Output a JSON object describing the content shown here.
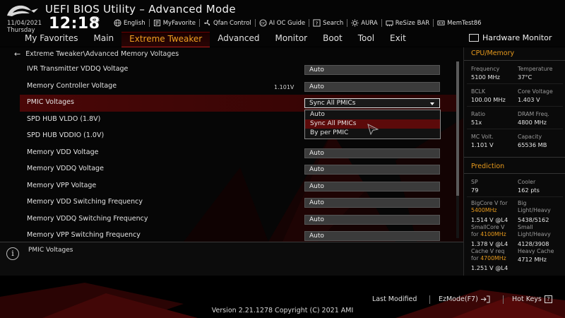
{
  "header": {
    "title": "UEFI BIOS Utility – Advanced Mode",
    "date": "11/04/2021",
    "day": "Thursday",
    "time": "12:18",
    "toolbar": [
      {
        "label": "English",
        "icon": "globe-icon"
      },
      {
        "label": "MyFavorite",
        "icon": "favorite-icon"
      },
      {
        "label": "Qfan Control",
        "icon": "fan-icon"
      },
      {
        "label": "AI OC Guide",
        "icon": "ai-oc-icon"
      },
      {
        "label": "Search",
        "icon": "search-icon"
      },
      {
        "label": "AURA",
        "icon": "aura-icon"
      },
      {
        "label": "ReSize BAR",
        "icon": "resize-bar-icon"
      },
      {
        "label": "MemTest86",
        "icon": "memtest-icon"
      }
    ]
  },
  "nav": {
    "tabs": [
      "My Favorites",
      "Main",
      "Extreme Tweaker",
      "Advanced",
      "Monitor",
      "Boot",
      "Tool",
      "Exit"
    ],
    "active": "Extreme Tweaker"
  },
  "breadcrumb": "Extreme Tweaker\\Advanced Memory Voltages",
  "rows": [
    {
      "label": "IVR Transmitter VDDQ Voltage",
      "measured": "",
      "value": "Auto"
    },
    {
      "label": "Memory Controller Voltage",
      "measured": "1.101V",
      "value": "Auto"
    },
    {
      "label": "PMIC Voltages",
      "measured": "",
      "value": "Sync All PMICs"
    },
    {
      "label": "SPD HUB VLDO (1.8V)",
      "measured": "",
      "value": ""
    },
    {
      "label": "SPD HUB VDDIO (1.0V)",
      "measured": "",
      "value": ""
    },
    {
      "label": "Memory VDD Voltage",
      "measured": "",
      "value": "Auto"
    },
    {
      "label": "Memory VDDQ Voltage",
      "measured": "",
      "value": "Auto"
    },
    {
      "label": "Memory VPP Voltage",
      "measured": "",
      "value": "Auto"
    },
    {
      "label": "Memory VDD Switching Frequency",
      "measured": "",
      "value": "Auto"
    },
    {
      "label": "Memory VDDQ Switching Frequency",
      "measured": "",
      "value": "Auto"
    },
    {
      "label": "Memory VPP Switching Frequency",
      "measured": "",
      "value": "Auto"
    }
  ],
  "dropdown": {
    "options": [
      "Auto",
      "Sync All PMICs",
      "By per PMIC"
    ],
    "selected": "Sync All PMICs"
  },
  "help_text": "PMIC Voltages",
  "hw_monitor": {
    "title": "Hardware Monitor",
    "cpu_memory": {
      "title": "CPU/Memory",
      "frequency_label": "Frequency",
      "frequency": "5100 MHz",
      "temperature_label": "Temperature",
      "temperature": "37°C",
      "bclk_label": "BCLK",
      "bclk": "100.00 MHz",
      "core_voltage_label": "Core Voltage",
      "core_voltage": "1.403 V",
      "ratio_label": "Ratio",
      "ratio": "51x",
      "dram_freq_label": "DRAM Freq.",
      "dram_freq": "4800 MHz",
      "mc_volt_label": "MC Volt.",
      "mc_volt": "1.101 V",
      "capacity_label": "Capacity",
      "capacity": "65536 MB"
    },
    "prediction": {
      "title": "Prediction",
      "sp_label": "SP",
      "sp": "79",
      "cooler_label": "Cooler",
      "cooler": "162 pts",
      "bigcore_label_a": "BigCore V for",
      "bigcore_freq": "5400MHz",
      "bigcore_value": "1.514 V @L4",
      "big_label_a": "Big",
      "big_label_b": "Light/Heavy",
      "big_value": "5438/5162",
      "smallcore_label_a": "SmallCore V",
      "smallcore_label_b": "for",
      "smallcore_freq": "4100MHz",
      "smallcore_value": "1.378 V @L4",
      "small_label_a": "Small",
      "small_label_b": "Light/Heavy",
      "small_value": "4128/3908",
      "cache_label_a": "Cache V req",
      "cache_label_b": "for",
      "cache_freq": "4700MHz",
      "cache_value": "1.251 V @L4",
      "heavy_cache_label": "Heavy Cache",
      "heavy_cache": "4712 MHz"
    }
  },
  "footer": {
    "last_modified": "Last Modified",
    "ezmode": "EzMode(F7)",
    "hotkeys": "Hot Keys",
    "version": "Version 2.21.1278 Copyright (C) 2021 AMI"
  },
  "colors": {
    "accent": "#e89a1c",
    "highlight_row": "#4a0707",
    "selected_option": "#5c0a0a",
    "value_box": "#3b3b3b"
  }
}
